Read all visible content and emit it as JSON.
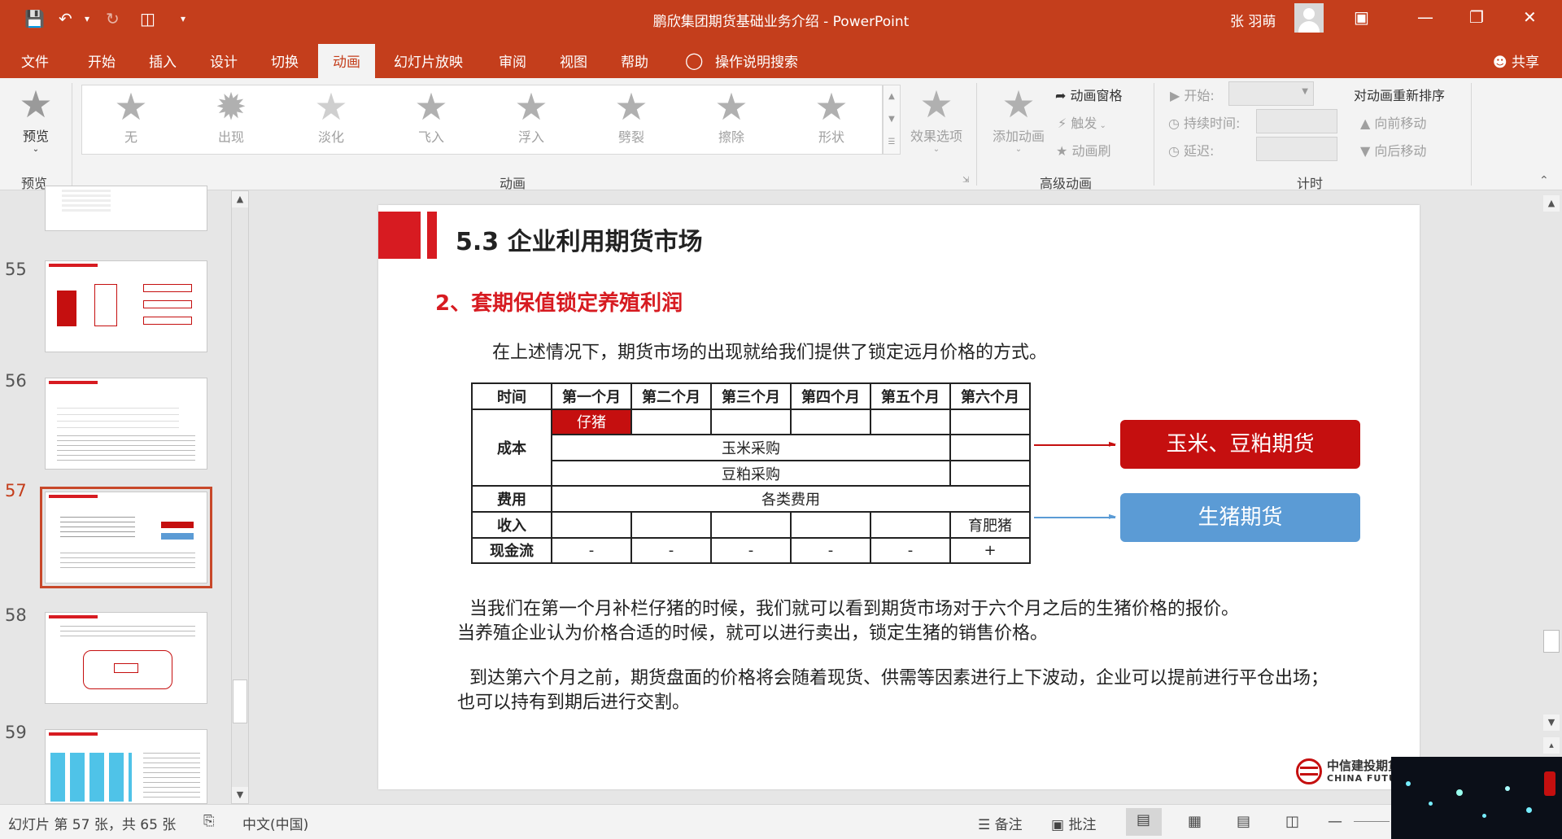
{
  "titlebar": {
    "title": "鹏欣集团期货基础业务介绍 - PowerPoint",
    "user": "张 羽萌"
  },
  "tabs": [
    "文件",
    "开始",
    "插入",
    "设计",
    "切换",
    "动画",
    "幻灯片放映",
    "审阅",
    "视图",
    "帮助",
    "操作说明搜索"
  ],
  "share_label": "共享",
  "ribbon": {
    "preview_label": "预览",
    "preview_group": "预览",
    "animations": [
      "无",
      "出现",
      "淡化",
      "飞入",
      "浮入",
      "劈裂",
      "擦除",
      "形状"
    ],
    "effect_options": "效果选项",
    "animation_group": "动画",
    "add_animation": "添加动画",
    "animation_pane": "动画窗格",
    "trigger": "触发",
    "animation_painter": "动画刷",
    "advanced_group": "高级动画",
    "start_label": "开始:",
    "duration_label": "持续时间:",
    "delay_label": "延迟:",
    "reorder_label": "对动画重新排序",
    "move_earlier": "向前移动",
    "move_later": "向后移动",
    "timing_group": "计时"
  },
  "thumbnails": {
    "numbers": [
      "55",
      "56",
      "57",
      "58",
      "59"
    ],
    "selected": "57"
  },
  "slide": {
    "title": "5.3  企业利用期货市场",
    "subtitle": "2、套期保值锁定养殖利润",
    "intro": "在上述情况下，期货市场的出现就给我们提供了锁定远月价格的方式。",
    "table": {
      "headers": [
        "时间",
        "第一个月",
        "第二个月",
        "第三个月",
        "第四个月",
        "第五个月",
        "第六个月"
      ],
      "cost_label": "成本",
      "piglet": "仔猪",
      "corn": "玉米采购",
      "soymeal": "豆粕采购",
      "fee_label": "费用",
      "fees": "各类费用",
      "income_label": "收入",
      "fattened": "育肥猪",
      "cashflow_label": "现金流",
      "cashflow": [
        "-",
        "-",
        "-",
        "-",
        "-",
        "+"
      ]
    },
    "box_red": "玉米、豆粕期货",
    "box_blue": "生猪期货",
    "para1_line1": "当我们在第一个月补栏仔猪的时候，我们就可以看到期货市场对于六个月之后的生猪价格的报价。",
    "para1_line2": "当养殖企业认为价格合适的时候，就可以进行卖出，锁定生猪的销售价格。",
    "para2_line1": "到达第六个月之前，期货盘面的价格将会随着现货、供需等因素进行上下波动，企业可以提前进行平仓出场；",
    "para2_line2": "也可以持有到期后进行交割。",
    "logo_cn": "中信建投期货",
    "logo_en": "CHINA FUTU"
  },
  "status": {
    "slide_info": "幻灯片 第 57 张，共 65 张",
    "language": "中文(中国)",
    "notes": "备注",
    "comments": "批注"
  },
  "colors": {
    "accent": "#c43e1c",
    "slide_red": "#d71b21",
    "box_red": "#c50f0f",
    "box_blue": "#5b9bd5"
  }
}
